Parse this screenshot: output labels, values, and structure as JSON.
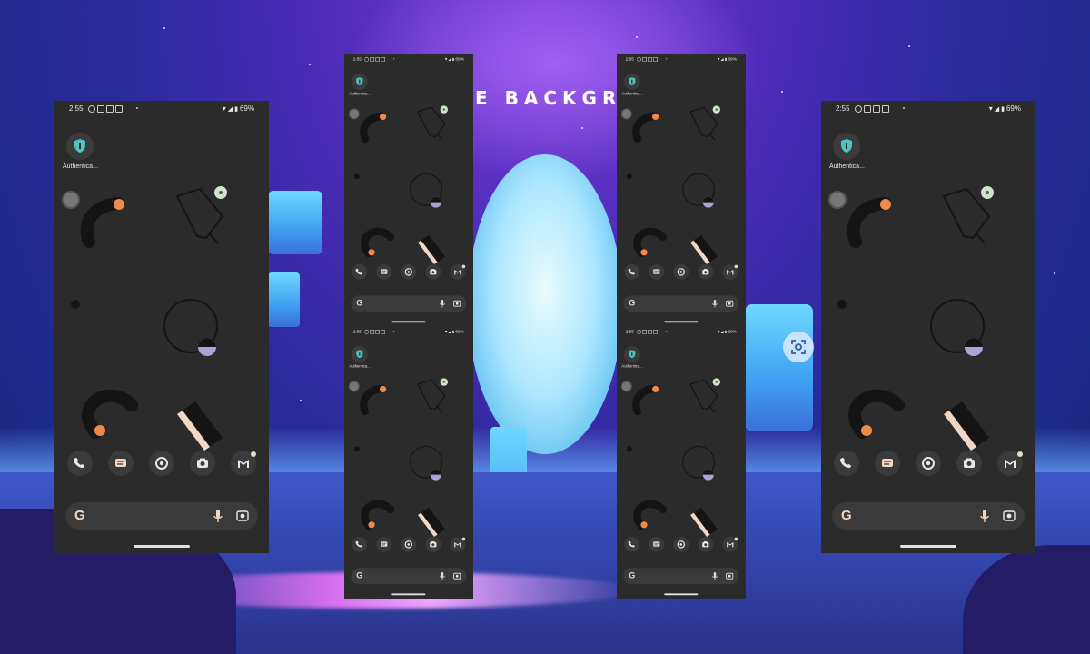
{
  "background": {
    "banner_text": "E BACKGR",
    "palette": {
      "sky": "#4b2bb8",
      "moon": "#aee8ff",
      "floor": "#3447b0",
      "accent": "#d66ef0"
    }
  },
  "phones": [
    {
      "time": "2:55",
      "battery": "69%",
      "app_label": "Authentica..."
    },
    {
      "time": "2:55",
      "battery": "69%",
      "app_label": "Authentica..."
    },
    {
      "time": "2:55",
      "battery": "69%",
      "app_label": "Authentica..."
    },
    {
      "time": "2:55",
      "battery": "69%",
      "app_label": "Authentica..."
    },
    {
      "time": "2:55",
      "battery": "69%",
      "app_label": "Authentica..."
    },
    {
      "time": "2:55",
      "battery": "69%",
      "app_label": "Authentica..."
    }
  ],
  "dock": {
    "icons": [
      "phone-icon",
      "messages-icon",
      "chrome-icon",
      "camera-icon",
      "gmail-icon"
    ]
  },
  "search": {
    "google_letter": "G",
    "icons": [
      "mic-icon",
      "lens-icon"
    ]
  },
  "colors": {
    "phone_bg": "#2b2b2b",
    "orange": "#f08a4b",
    "lilac": "#a9a3d9",
    "mint": "#cfe5c8",
    "cream": "#f1d7c4",
    "black": "#141414"
  },
  "overlay": {
    "icon": "screenshot-lens-icon"
  }
}
